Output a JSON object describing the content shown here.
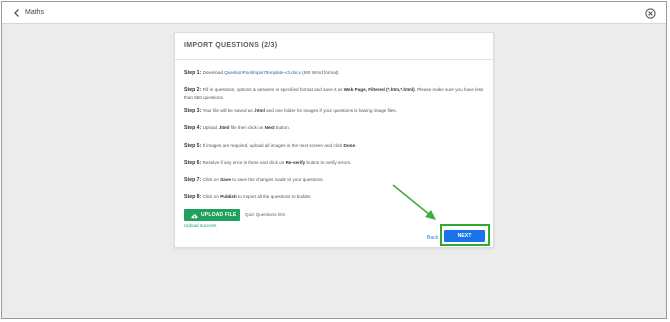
{
  "header": {
    "title": "Maths",
    "back_icon": "chevron-left-icon",
    "close_icon": "close-circle-icon"
  },
  "dialog": {
    "title": "IMPORT QUESTIONS (2/3)",
    "steps": [
      {
        "label": "Step 1:",
        "parts": [
          {
            "text": " Download ",
            "style": "plain"
          },
          {
            "text": "QuestionPoolImportTemplate-v3.docx",
            "style": "link"
          },
          {
            "text": " (MS Word format)",
            "style": "plain"
          }
        ]
      },
      {
        "label": "Step 2:",
        "parts": [
          {
            "text": " Fill in questions, options & answers in specified format and save it as ",
            "style": "plain"
          },
          {
            "text": "Web Page, Filtered (*.htm,*.html)",
            "style": "bold"
          },
          {
            "text": ". Please make sure you have less than 550 questions.",
            "style": "plain"
          }
        ]
      },
      {
        "label": "Step 3:",
        "parts": [
          {
            "text": " Your file will be saved as ",
            "style": "plain"
          },
          {
            "text": ".html",
            "style": "bold"
          },
          {
            "text": " and one folder for images if your questions is having image files.",
            "style": "plain"
          }
        ]
      },
      {
        "label": "Step 4:",
        "parts": [
          {
            "text": " Upload ",
            "style": "plain"
          },
          {
            "text": ".html",
            "style": "bold"
          },
          {
            "text": " file then click on ",
            "style": "plain"
          },
          {
            "text": "Next",
            "style": "bold"
          },
          {
            "text": " button.",
            "style": "plain"
          }
        ]
      },
      {
        "label": "Step 5:",
        "parts": [
          {
            "text": " If images are required, upload all images in the next screen and click ",
            "style": "plain"
          },
          {
            "text": "Done",
            "style": "bold"
          },
          {
            "text": ".",
            "style": "plain"
          }
        ]
      },
      {
        "label": "Step 6:",
        "parts": [
          {
            "text": " Resolve if any error is there and click on ",
            "style": "plain"
          },
          {
            "text": "Re-verify",
            "style": "bold"
          },
          {
            "text": " button to verify errors.",
            "style": "plain"
          }
        ]
      },
      {
        "label": "Step 7:",
        "parts": [
          {
            "text": " Click on ",
            "style": "plain"
          },
          {
            "text": "Save",
            "style": "bold"
          },
          {
            "text": " to save the changes made to your questions.",
            "style": "plain"
          }
        ]
      },
      {
        "label": "Step 8:",
        "parts": [
          {
            "text": " Click on ",
            "style": "plain"
          },
          {
            "text": "Publish",
            "style": "bold"
          },
          {
            "text": " to import all the questions to builder.",
            "style": "plain"
          }
        ]
      }
    ],
    "upload_button": {
      "label": "UPLOAD FILE",
      "icon": "cloud-upload-icon"
    },
    "file_name": "Quiz Questions.htm",
    "upload_status": "Upload success",
    "back_label": "Back",
    "next_label": "NEXT"
  },
  "colors": {
    "upload_green": "#1fa05c",
    "next_blue": "#1a73e8",
    "highlight_green": "#2faa2f",
    "link_blue": "#2a5db0"
  }
}
